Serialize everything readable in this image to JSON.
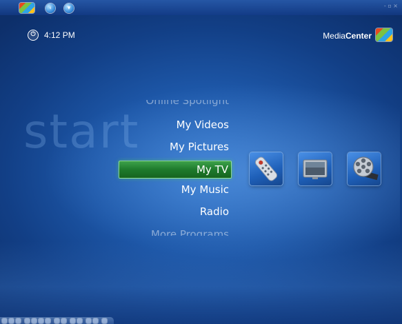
{
  "titlebar": {
    "back_icon": "left-arrow",
    "forward_icon": "down-arrow",
    "window_controls": "- ▫ ×"
  },
  "header": {
    "time": "4:12 PM",
    "power_icon": "power-icon",
    "brand_prefix": "Media",
    "brand_suffix": "Center"
  },
  "watermark": "start",
  "menu": {
    "items": [
      {
        "label": "Online Spotlight",
        "state": "faded"
      },
      {
        "label": "My Videos",
        "state": "normal"
      },
      {
        "label": "My Pictures",
        "state": "normal"
      },
      {
        "label": "My TV",
        "state": "selected"
      },
      {
        "label": "My Music",
        "state": "normal"
      },
      {
        "label": "Radio",
        "state": "normal"
      },
      {
        "label": "More Programs",
        "state": "faded"
      }
    ]
  },
  "tiles": [
    {
      "name": "remote-control-icon"
    },
    {
      "name": "tv-monitor-icon"
    },
    {
      "name": "film-reel-icon"
    }
  ],
  "colors": {
    "background": "#1d57a8",
    "selection": "#1e7a2c"
  }
}
